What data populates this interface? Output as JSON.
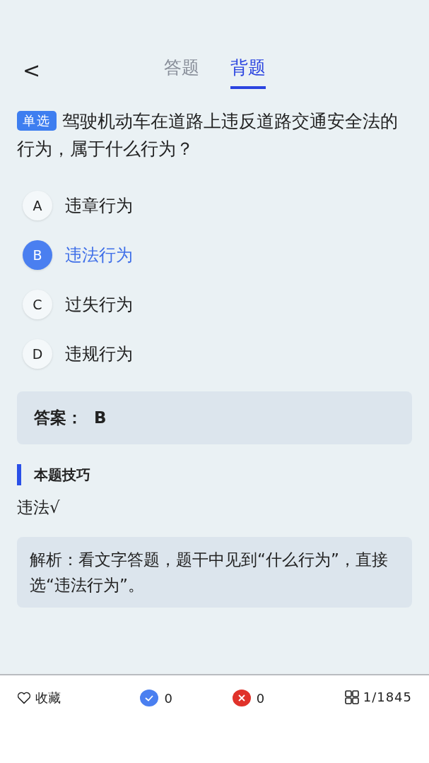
{
  "header": {
    "back": "<",
    "tabs": [
      {
        "label": "答题",
        "selected": false
      },
      {
        "label": "背题",
        "selected": true
      }
    ]
  },
  "question": {
    "type_tag": "单选",
    "text": "驾驶机动车在道路上违反道路交通安全法的行为，属于什么行为？"
  },
  "options": [
    {
      "letter": "A",
      "text": "违章行为",
      "selected": false
    },
    {
      "letter": "B",
      "text": "违法行为",
      "selected": true
    },
    {
      "letter": "C",
      "text": "过失行为",
      "selected": false
    },
    {
      "letter": "D",
      "text": "违规行为",
      "selected": false
    }
  ],
  "answer": "答案：  B",
  "tips": {
    "heading": "本题技巧",
    "text": "违法√"
  },
  "analysis": "解析：看文字答题，题干中见到“什么行为”，直接选“违法行为”。",
  "bottom_bar": {
    "favorite": "收藏",
    "correct": "0",
    "wrong": "0",
    "progress": "1/1845"
  }
}
